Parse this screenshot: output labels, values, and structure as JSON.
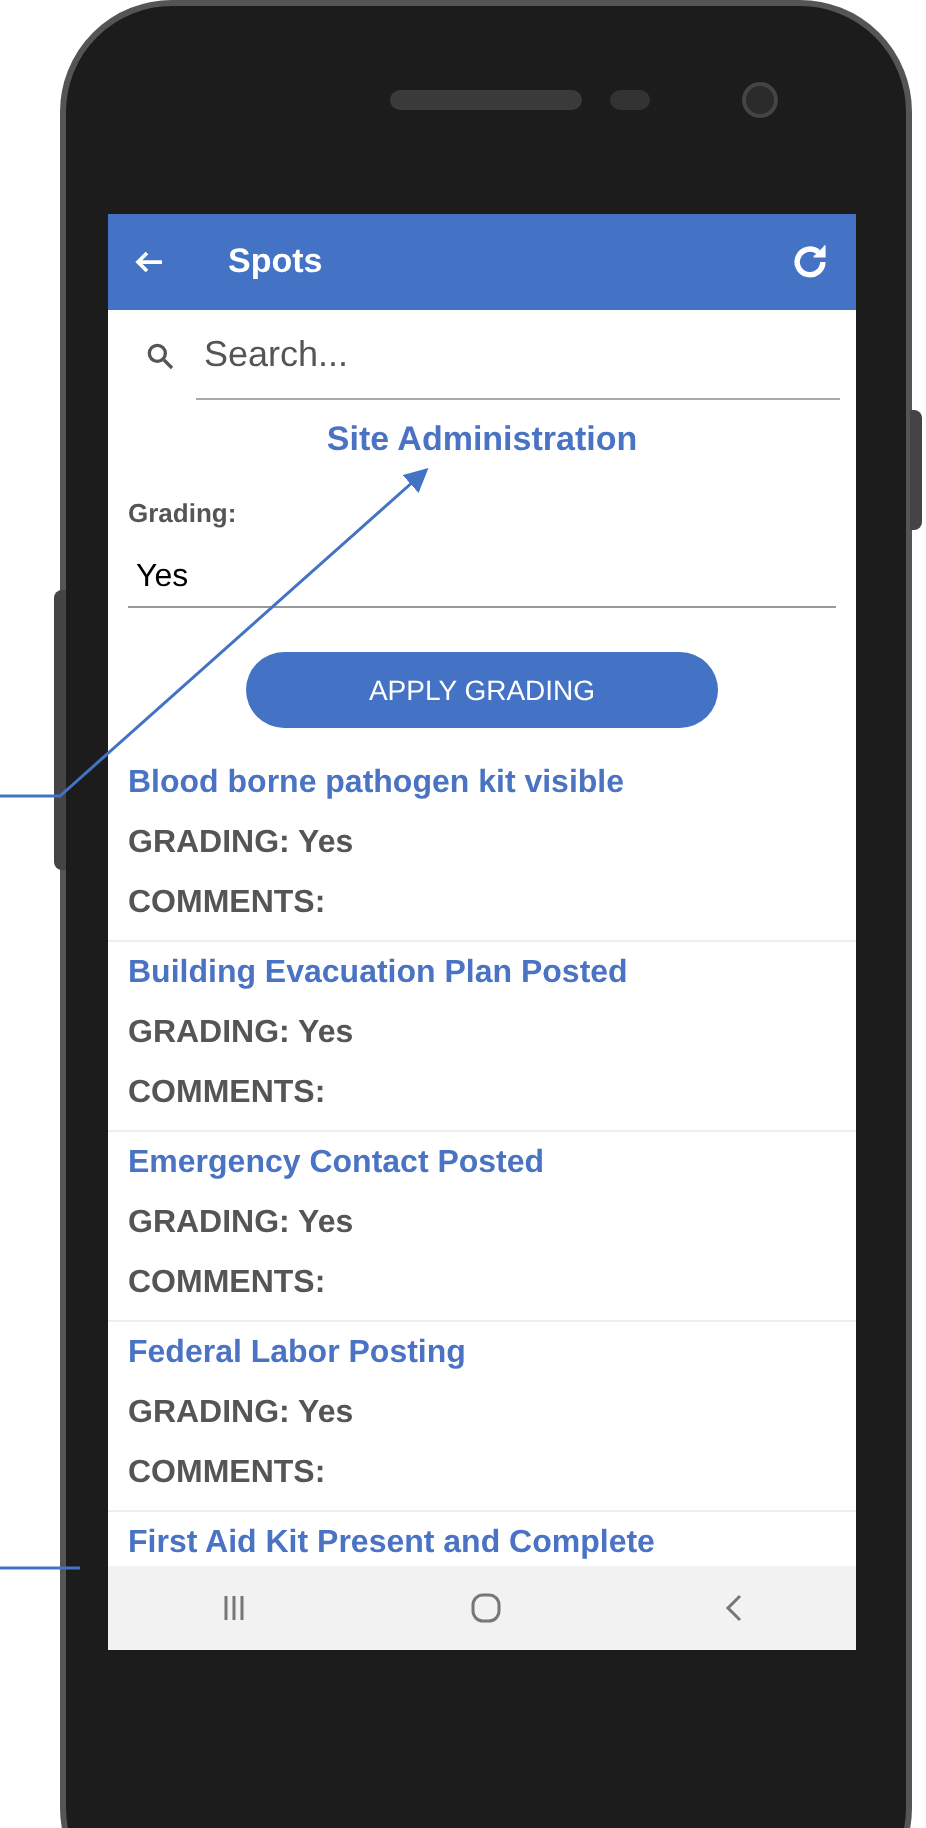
{
  "app_bar": {
    "title": "Spots"
  },
  "search": {
    "placeholder": "Search..."
  },
  "section_title": "Site Administration",
  "grading": {
    "label": "Grading:",
    "value": "Yes"
  },
  "apply_button": "APPLY GRADING",
  "items": [
    {
      "title": "Blood borne pathogen kit visible",
      "grading": "GRADING: Yes",
      "comments": "COMMENTS:"
    },
    {
      "title": "Building Evacuation Plan Posted",
      "grading": "GRADING: Yes",
      "comments": "COMMENTS:"
    },
    {
      "title": "Emergency Contact Posted",
      "grading": "GRADING: Yes",
      "comments": "COMMENTS:"
    },
    {
      "title": "Federal Labor Posting",
      "grading": "GRADING: Yes",
      "comments": "COMMENTS:"
    },
    {
      "title": "First Aid Kit Present and Complete"
    }
  ]
}
